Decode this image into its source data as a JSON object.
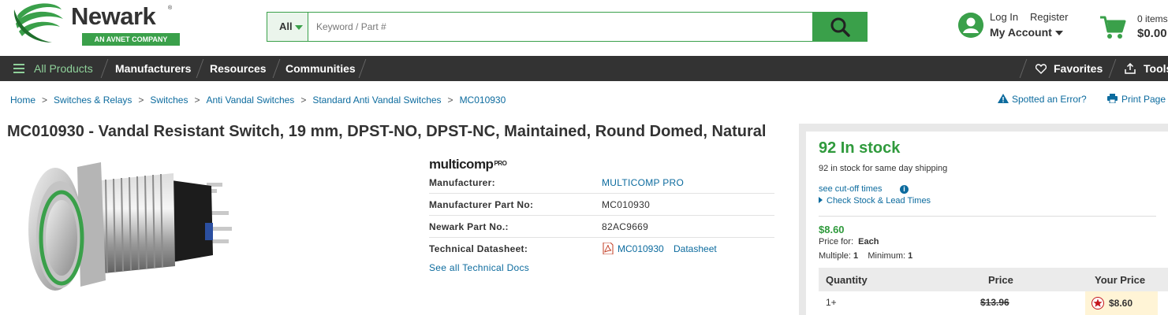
{
  "header": {
    "logo_text": "Newark",
    "logo_reg": "®",
    "logo_tagline": "AN AVNET COMPANY",
    "search_category": "All",
    "search_placeholder": "Keyword / Part #",
    "login": "Log In",
    "register": "Register",
    "my_account": "My Account",
    "cart_items": "0 items",
    "cart_total": "$0.00"
  },
  "nav": {
    "all_products": "All Products",
    "manufacturers": "Manufacturers",
    "resources": "Resources",
    "communities": "Communities",
    "favorites": "Favorites",
    "tools": "Tools"
  },
  "breadcrumb": [
    "Home",
    "Switches & Relays",
    "Switches",
    "Anti Vandal Switches",
    "Standard Anti Vandal Switches",
    "MC010930"
  ],
  "breadcrumb_sep": ">",
  "page_links": {
    "error": "Spotted an Error?",
    "print": "Print Page"
  },
  "product": {
    "title": "MC010930 -  Vandal Resistant Switch, 19 mm, DPST-NO, DPST-NC, Maintained, Round Domed, Natural",
    "brand": "multicomp",
    "brand_suffix": "PRO",
    "specs": [
      {
        "label": "Manufacturer:",
        "value": "MULTICOMP PRO"
      },
      {
        "label": "Manufacturer Part No:",
        "value": "MC010930"
      },
      {
        "label": "Newark Part No.:",
        "value": "82AC9669"
      },
      {
        "label": "Technical Datasheet:",
        "value": "MC010930",
        "value2": "Datasheet"
      }
    ],
    "see_all_docs": "See all Technical Docs"
  },
  "buybox": {
    "stock_title": "92 In stock",
    "stock_sub": "92 in stock for same day shipping",
    "cutoff": "see cut-off times",
    "check_stock": "Check Stock & Lead Times",
    "price": "$8.60",
    "price_for_label": "Price for:",
    "price_for_value": "Each",
    "multiple_label": "Multiple:",
    "multiple_value": "1",
    "minimum_label": "Minimum:",
    "minimum_value": "1",
    "table_headers": [
      "Quantity",
      "Price",
      "Your Price"
    ],
    "rows": [
      {
        "qty": "1+",
        "price": "$13.96",
        "your_price": "$8.60"
      }
    ]
  },
  "colors": {
    "brand_green": "#3aa04a",
    "nav_bg": "#333333",
    "link_blue": "#0c6b9e",
    "stock_green": "#2f9a3c"
  },
  "icons": [
    "newark-logo-icon",
    "search-icon",
    "account-icon",
    "cart-icon",
    "menu-icon",
    "heart-icon",
    "upload-icon",
    "warning-icon",
    "print-icon",
    "pdf-icon",
    "info-icon",
    "star-icon"
  ]
}
